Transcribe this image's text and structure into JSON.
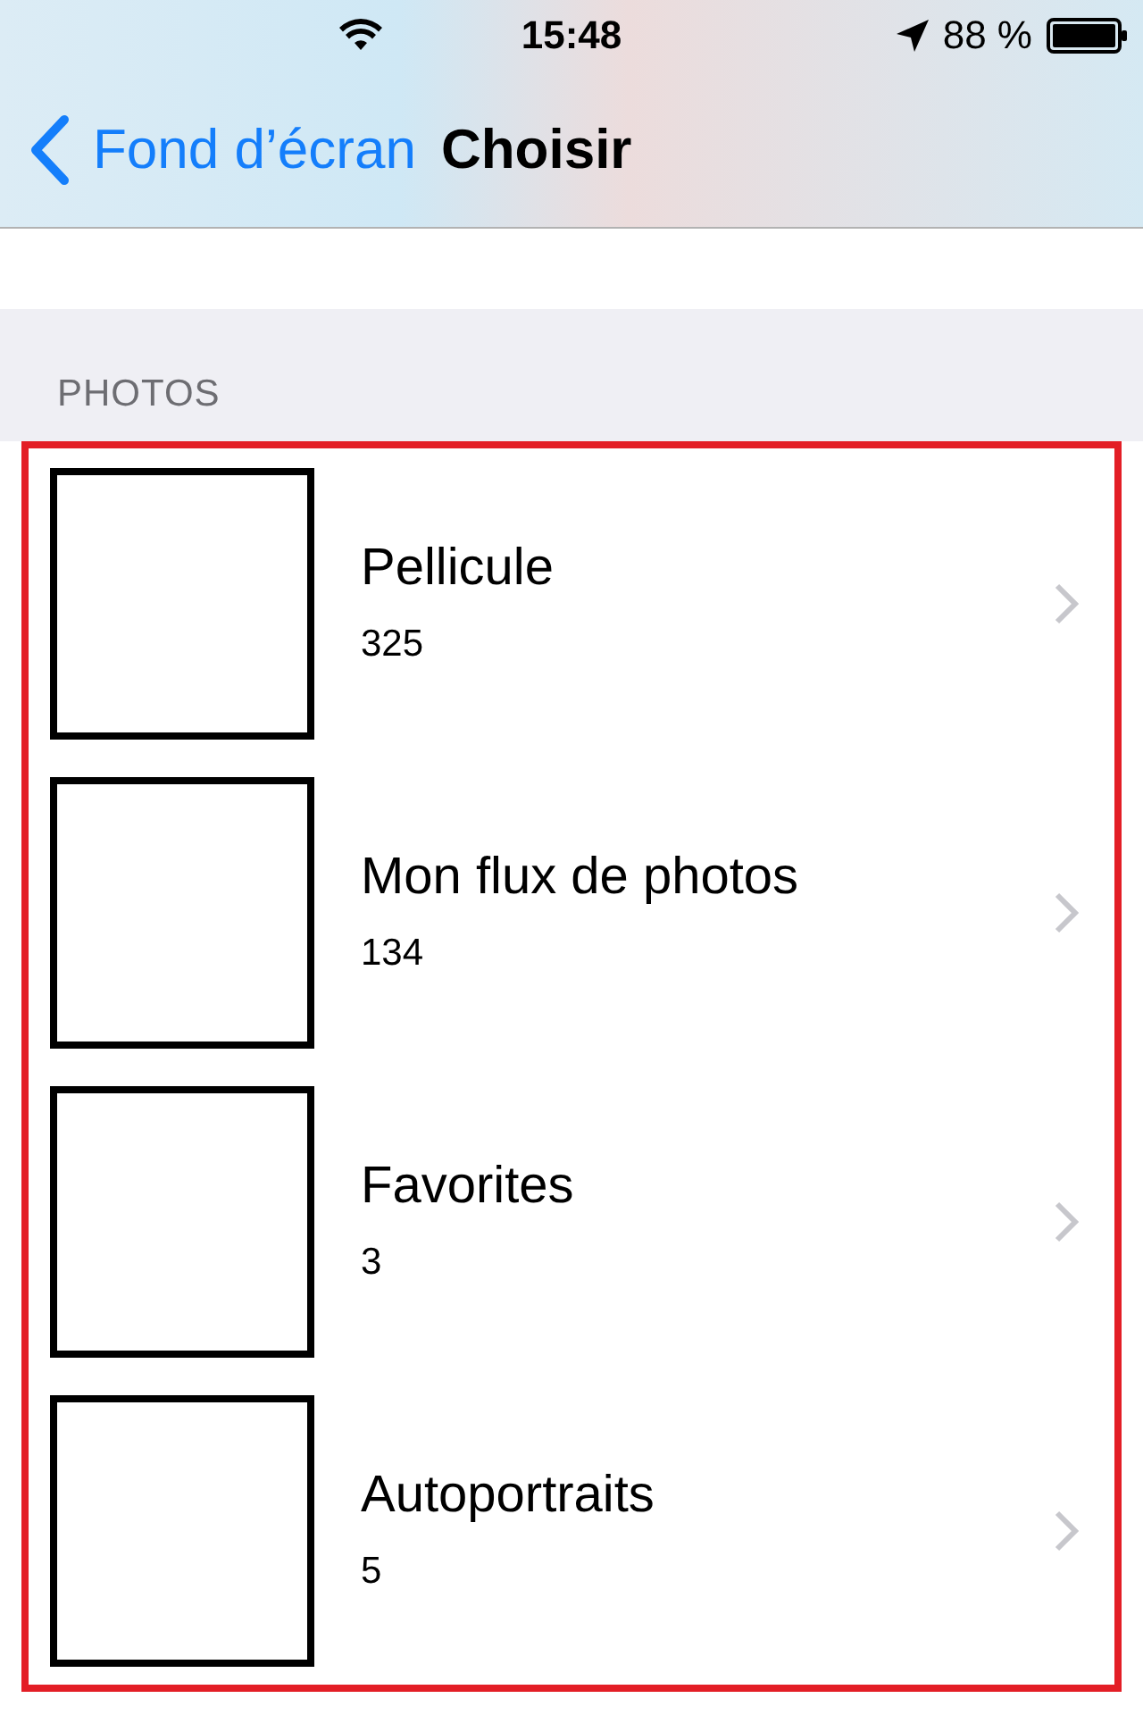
{
  "status_bar": {
    "time": "15:48",
    "battery": "88 %"
  },
  "nav_bar": {
    "back": "Fond d’écran",
    "title": "Choisir"
  },
  "section": {
    "header": "PHOTOS"
  },
  "albums": [
    {
      "name": "Pellicule",
      "count": "325"
    },
    {
      "name": "Mon flux de photos",
      "count": "134"
    },
    {
      "name": "Favorites",
      "count": "3"
    },
    {
      "name": "Autoportraits",
      "count": "5"
    }
  ]
}
